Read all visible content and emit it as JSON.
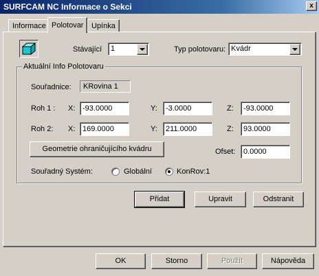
{
  "window": {
    "title": "SURFCAM NC Informace o Sekci",
    "close_glyph": "x"
  },
  "tabs": [
    {
      "label": "Informace"
    },
    {
      "label": "Polotovar"
    },
    {
      "label": "Upínka"
    }
  ],
  "stock": {
    "icon": "box-stock-icon",
    "current_label": "Stávající",
    "current_value": "1",
    "type_label": "Typ polotovaru:",
    "type_value": "Kvádr"
  },
  "group": {
    "title": "Aktuální Info Polotovaru",
    "coords_label": "Souřadnice:",
    "coords_value": "KRovina 1",
    "corner1": {
      "label": "Roh 1 :",
      "x_label": "X:",
      "x": "-93.0000",
      "y_label": "Y:",
      "y": "-3.0000",
      "z_label": "Z:",
      "z": "-93.0000"
    },
    "corner2": {
      "label": "Roh 2:",
      "x_label": "X:",
      "x": "169.0000",
      "y_label": "Y:",
      "y": "211.0000",
      "z_label": "Z:",
      "z": "93.0000"
    },
    "bbox_button": "Geometrie ohraničujícího kvádru",
    "offset_label": "Ofset:",
    "offset_value": "0.0000",
    "coord_system_label": "Souřadný Systém:",
    "radio_global": "Globální",
    "radio_local": "KonRov:1",
    "selected": "local"
  },
  "actions": {
    "add": "Přidat",
    "edit": "Upravit",
    "remove": "Odstranit"
  },
  "footer": {
    "ok": "OK",
    "cancel": "Storno",
    "apply": "Použít",
    "help": "Nápověda"
  },
  "colors": {
    "titlebar_start": "#0a246a",
    "titlebar_end": "#a6caf0",
    "face": "#d4d0c8",
    "icon_cyan": "#19c8d2"
  }
}
